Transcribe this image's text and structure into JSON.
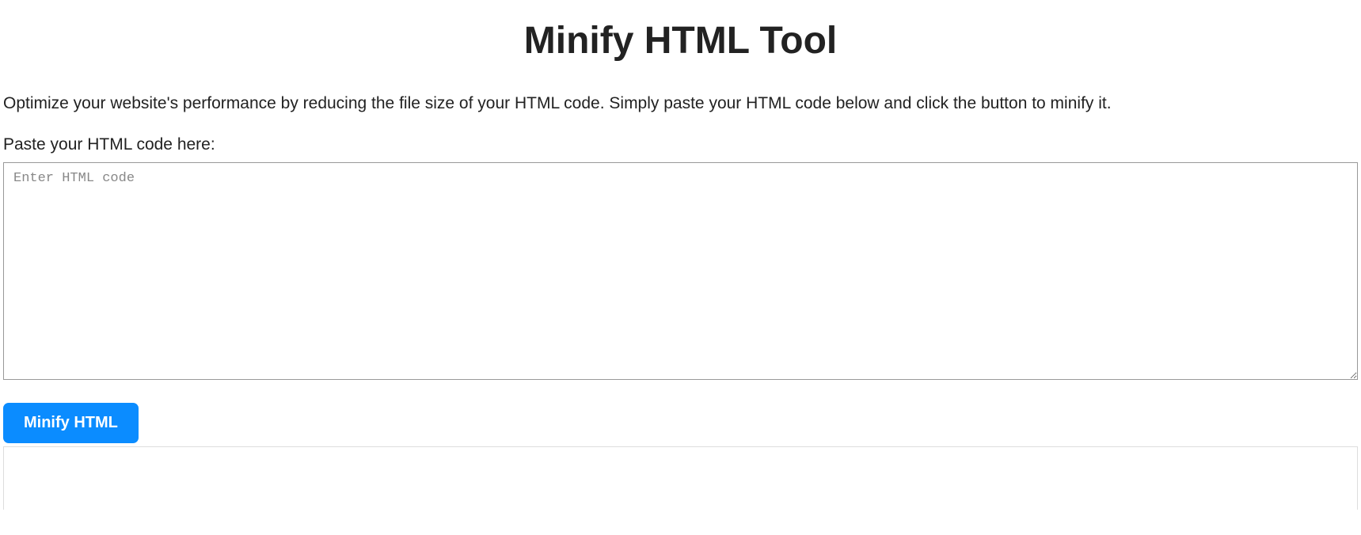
{
  "page": {
    "title": "Minify HTML Tool",
    "description": "Optimize your website's performance by reducing the file size of your HTML code. Simply paste your HTML code below and click the button to minify it."
  },
  "form": {
    "label": "Paste your HTML code here:",
    "placeholder": "Enter HTML code",
    "value": "",
    "buttonLabel": "Minify HTML"
  }
}
